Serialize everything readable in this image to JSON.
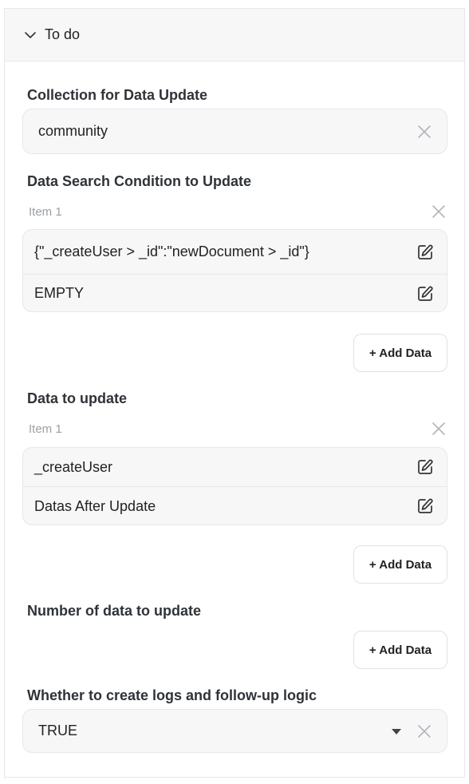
{
  "header": {
    "title": "To do",
    "icon": "chevron-down-icon"
  },
  "collection": {
    "label": "Collection for Data Update",
    "value": "community"
  },
  "search_condition": {
    "label": "Data Search Condition to Update",
    "item_label": "Item 1",
    "rows": [
      {
        "text": "{\"_createUser  >  _id\":\"newDocument  >  _id\"}"
      },
      {
        "text": "EMPTY"
      }
    ],
    "add_label": "+ Add Data"
  },
  "data_to_update": {
    "label": "Data to update",
    "item_label": "Item 1",
    "rows": [
      {
        "text": "_createUser"
      },
      {
        "text": "Datas After Update"
      }
    ],
    "add_label": "+ Add Data"
  },
  "number_of_data": {
    "label": "Number of data to update",
    "add_label": "+ Add Data"
  },
  "logs": {
    "label": "Whether to create logs and follow-up logic",
    "value": "TRUE"
  },
  "colors": {
    "border": "#e5e7eb",
    "field_bg": "#f7f7f8",
    "muted": "#9aa0a6",
    "text": "#222222"
  }
}
